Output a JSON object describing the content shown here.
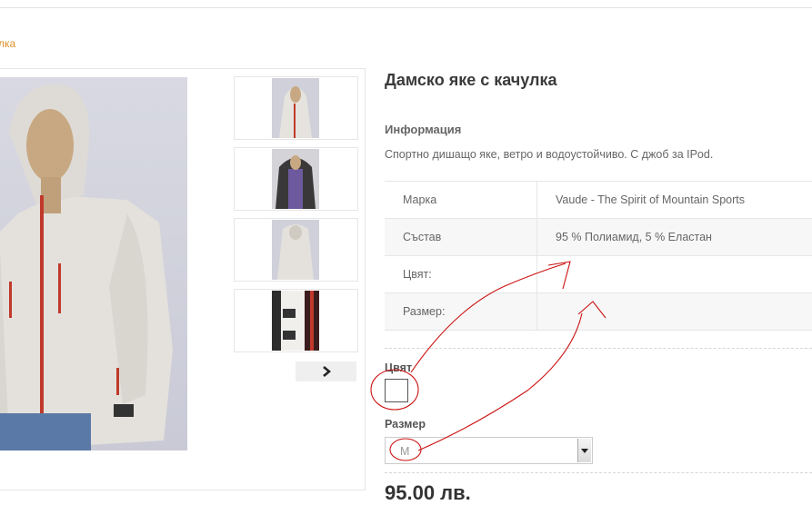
{
  "breadcrumb": {
    "current": "лка"
  },
  "product": {
    "title": "Дамско яке с качулка",
    "info_heading": "Информация",
    "description": "Спортно дишащо яке, ветро и водоустойчиво. С джоб за IPod.",
    "attributes": [
      {
        "name": "Марка",
        "value": "Vaude - The Spirit of Mountain Sports"
      },
      {
        "name": "Състав",
        "value": "95 % Полиамид, 5 % Еластан"
      },
      {
        "name": "Цвят:",
        "value": ""
      },
      {
        "name": "Размер:",
        "value": ""
      }
    ],
    "color_label": "Цвят",
    "size_label": "Размер",
    "size_selected": "M",
    "price": "95.00 лв."
  },
  "gallery": {
    "thumbnail_count": 4,
    "next_icon": "chevron-right-icon"
  },
  "colors": {
    "accent": "#e0922b",
    "annotation": "#cc1111"
  }
}
